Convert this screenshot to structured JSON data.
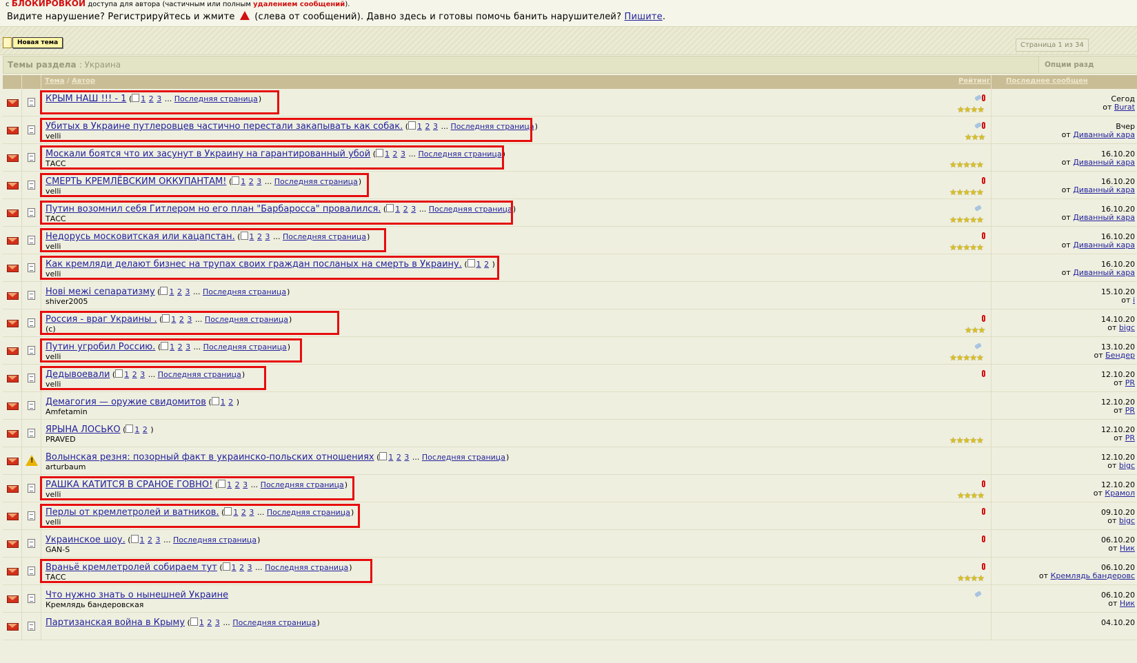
{
  "notice": {
    "line1_prefix": "с",
    "line1_block": "БЛОКИРОВКОЙ",
    "line1_mid": "доступа для автора (частичным или полным",
    "line1_red": "удалением сообщений",
    "line1_end": ").",
    "line2_a": "Видите нарушение? Регистрируйтесь и жмите",
    "line2_b": "(слева от сообщений). Давно здесь и готовы помочь банить нарушителей?",
    "line2_link": "Пишите",
    "line2_end": "."
  },
  "toolbar": {
    "new_topic": "Новая тема",
    "page_info": "Страница 1 из 34"
  },
  "section": {
    "label": "Темы раздела",
    "name": ": Украина",
    "options": "Опции разд"
  },
  "columns": {
    "topic": "Тема",
    "sep": "/",
    "author": "Автор",
    "rating": "Рейтинг",
    "last": "Последнее сообщен"
  },
  "pagination": {
    "p1": "1",
    "p2": "2",
    "p3": "3",
    "dots": "...",
    "last": "Последняя страница"
  },
  "topics": [
    {
      "title": "КРЫМ НАШ !!! - 1",
      "author": "",
      "pages": 3,
      "last_date": "Сегод",
      "last_by": "Burat",
      "stars": 4,
      "clip": true,
      "tag": true,
      "hl_w": 347,
      "icon": "doc"
    },
    {
      "title": "Убитых в Украине путлеровцев частично перестали закапывать как собак.",
      "author": "velli",
      "pages": 3,
      "last_date": "Вчер",
      "last_by": "Диванный кара",
      "stars": 3,
      "clip": true,
      "tag": true,
      "hl_w": 714,
      "icon": "doc"
    },
    {
      "title": "Москали боятся что их засунут в Украину на гарантированный убой",
      "author": "ТАСС",
      "pages": 3,
      "last_date": "16.10.20",
      "last_by": "Диванный кара",
      "stars": 5,
      "clip": false,
      "tag": false,
      "hl_w": 673,
      "icon": "doc"
    },
    {
      "title": "СМЕРТЬ КРЕМЛЁВСКИМ ОККУПАНТАМ!",
      "author": "velli",
      "pages": 3,
      "last_date": "16.10.20",
      "last_by": "Диванный кара",
      "stars": 5,
      "clip": true,
      "tag": false,
      "hl_w": 477,
      "icon": "doc"
    },
    {
      "title": "Путин возомнил себя Гитлером но его план \"Барбаросса\" провалился.",
      "author": "ТАСС",
      "pages": 3,
      "last_date": "16.10.20",
      "last_by": "Диванный кара",
      "stars": 5,
      "clip": false,
      "tag": true,
      "hl_w": 686,
      "icon": "doc"
    },
    {
      "title": "Недорусь московитская или кацапстан.",
      "author": "velli",
      "pages": 3,
      "last_date": "16.10.20",
      "last_by": "Диванный кара",
      "stars": 5,
      "clip": true,
      "tag": false,
      "hl_w": 502,
      "icon": "doc"
    },
    {
      "title": "Как кремляди делают бизнес на трупах своих граждан посланых на смерть в Украину.",
      "author": "velli",
      "pages": 2,
      "last_date": "16.10.20",
      "last_by": "Диванный кара",
      "stars": 0,
      "clip": false,
      "tag": false,
      "hl_w": 666,
      "icon": "doc"
    },
    {
      "title": "Нові межі сепаратизму",
      "author": "shiver2005",
      "pages": 3,
      "last_date": "15.10.20",
      "last_by": "i",
      "stars": 0,
      "clip": false,
      "tag": false,
      "hl_w": 0,
      "icon": "doc"
    },
    {
      "title": "Россия - враг Украины .",
      "author": "(c)",
      "pages": 3,
      "last_date": "14.10.20",
      "last_by": "bigc",
      "stars": 3,
      "clip": true,
      "tag": false,
      "hl_w": 434,
      "icon": "doc"
    },
    {
      "title": "Путин угробил Россию.",
      "author": "velli",
      "pages": 3,
      "last_date": "13.10.20",
      "last_by": "Бендер",
      "stars": 5,
      "clip": false,
      "tag": true,
      "hl_w": 380,
      "icon": "doc"
    },
    {
      "title": "Дедывоевали",
      "author": "velli",
      "pages": 3,
      "last_date": "12.10.20",
      "last_by": "PR",
      "stars": 0,
      "clip": true,
      "tag": false,
      "hl_w": 328,
      "icon": "doc"
    },
    {
      "title": "Демагогия — оружие свидомитов",
      "author": "Amfetamin",
      "pages": 2,
      "last_date": "12.10.20",
      "last_by": "PR",
      "stars": 0,
      "clip": false,
      "tag": false,
      "hl_w": 0,
      "icon": "doc"
    },
    {
      "title": "ЯРЫНА ЛОСЬКО",
      "author": "PRAVED",
      "pages": 2,
      "last_date": "12.10.20",
      "last_by": "PR",
      "stars": 5,
      "clip": false,
      "tag": false,
      "hl_w": 0,
      "icon": "doc"
    },
    {
      "title": "Волынская резня: позорный факт в украинско-польских отношениях",
      "author": "arturbaum",
      "pages": 3,
      "last_date": "12.10.20",
      "last_by": "bigc",
      "stars": 0,
      "clip": false,
      "tag": false,
      "hl_w": 0,
      "icon": "warn"
    },
    {
      "title": "РАШКА КАТИТСЯ В СРАНОЕ ГОВНО!",
      "author": "velli",
      "pages": 3,
      "last_date": "12.10.20",
      "last_by": "Крамол",
      "stars": 4,
      "clip": true,
      "tag": false,
      "hl_w": 456,
      "icon": "doc"
    },
    {
      "title": "Перлы от кремлетролей и ватников.",
      "author": "velli",
      "pages": 3,
      "last_date": "09.10.20",
      "last_by": "bigc",
      "stars": 0,
      "clip": true,
      "tag": false,
      "hl_w": 464,
      "icon": "doc"
    },
    {
      "title": "Украинское шоу.",
      "author": "GAN-S",
      "pages": 3,
      "last_date": "06.10.20",
      "last_by": "Ник",
      "stars": 0,
      "clip": true,
      "tag": false,
      "hl_w": 0,
      "icon": "doc"
    },
    {
      "title": "Враньё кремлетролей собираем тут",
      "author": "ТАСС",
      "pages": 3,
      "last_date": "06.10.20",
      "last_by": "Кремлядь бандеровс",
      "stars": 4,
      "clip": true,
      "tag": false,
      "hl_w": 482,
      "icon": "doc"
    },
    {
      "title": "Что нужно знать о нынешней Украине",
      "author": "Кремлядь бандеровская",
      "pages": 0,
      "last_date": "06.10.20",
      "last_by": "Ник",
      "stars": 0,
      "clip": false,
      "tag": true,
      "hl_w": 0,
      "icon": "doc"
    },
    {
      "title": "Партизанская война в Крыму",
      "author": "",
      "pages": 3,
      "last_date": "04.10.20",
      "last_by": "",
      "stars": 0,
      "clip": false,
      "tag": false,
      "hl_w": 0,
      "icon": "doc"
    }
  ],
  "last_prefix": "от",
  "star_char": "★"
}
